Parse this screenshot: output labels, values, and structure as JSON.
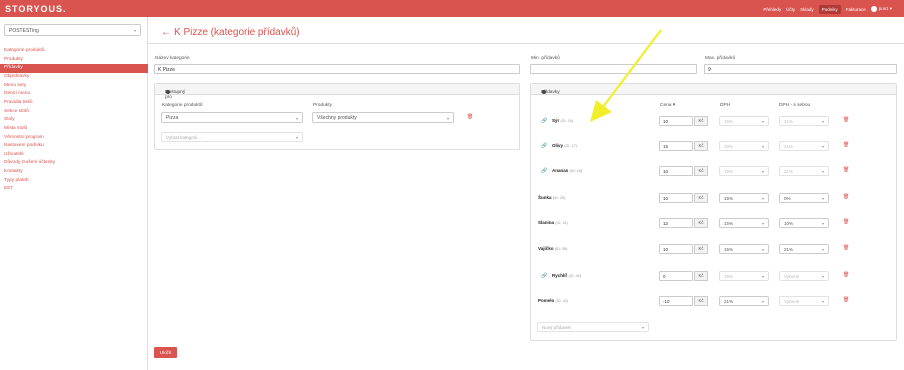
{
  "app": {
    "logo": "STORYOUS."
  },
  "topnav": {
    "items": [
      "Přehledy",
      "Účty",
      "Sklady",
      "Podniky",
      "Fakturace"
    ],
    "active": "Podniky",
    "user": "pos1 ▾"
  },
  "sidebar": {
    "business_select": "POSTESTing",
    "items": [
      "Kategorie produktů",
      "Produkty",
      "Přídavky",
      "Objednávky",
      "Menu sety",
      "Denní menu",
      "Pravidla tisků",
      "Sekce stolů",
      "Stoly",
      "Místa stolů",
      "Věrnostní program",
      "Nastavení podniku",
      "Uživatelé",
      "Důvody zrušení účtenky",
      "Kontakty",
      "Typy plateb",
      "EET"
    ],
    "active_item": "Přídavky"
  },
  "page": {
    "back": "←",
    "title": "K Pizze (kategorie přídavků)"
  },
  "form": {
    "category_name_label": "Název kategorie",
    "category_name_value": "K Pizze",
    "min_label": "Min. přídavků",
    "min_value": "",
    "max_label": "Max. přídavků",
    "max_value": "9"
  },
  "available_for": {
    "title": "Dostupný pro",
    "col_category": "Kategorie produktů",
    "col_products": "Produkty",
    "category_value": "Pizza",
    "products_value": "Všechny produkty",
    "choose_category_placeholder": "Vybrat kategorii..."
  },
  "addons": {
    "title": "Přídavky",
    "col_price": "Cena ▾",
    "col_vat": "DPH",
    "col_vat_takeaway": "DPH - s sebou",
    "currency": "Kč",
    "rows": [
      {
        "name": "Sýr",
        "id": "(ID: 19)",
        "linked": true,
        "price": "10",
        "vat": "15%",
        "vat_takeaway": "21%",
        "dim": true
      },
      {
        "name": "Olivy",
        "id": "(ID: 17)",
        "linked": true,
        "price": "15",
        "vat": "15%",
        "vat_takeaway": "21%",
        "dim": true
      },
      {
        "name": "Ananas",
        "id": "(ID: 18)",
        "linked": true,
        "price": "10",
        "vat": "15%",
        "vat_takeaway": "21%",
        "dim": true
      },
      {
        "name": "Šunka",
        "id": "(ID: 30)",
        "linked": false,
        "price": "10",
        "vat": "15%",
        "vat_takeaway": "0%",
        "dim": false
      },
      {
        "name": "Slanina",
        "id": "(ID: 31)",
        "linked": false,
        "price": "12",
        "vat": "15%",
        "vat_takeaway": "10%",
        "dim": false
      },
      {
        "name": "Vajíčko",
        "id": "(ID: 39)",
        "linked": false,
        "price": "10",
        "vat": "15%",
        "vat_takeaway": "21%",
        "dim": false
      },
      {
        "name": "Rychlíř",
        "id": "(ID: 40)",
        "linked": true,
        "price": "0",
        "vat": "15%",
        "vat_takeaway": "Vyberte",
        "dim": true
      },
      {
        "name": "Pomelo",
        "id": "(ID: 41)",
        "linked": false,
        "price": "-10",
        "vat": "21%",
        "vat_takeaway": "Vyberte",
        "dim": false
      }
    ],
    "new_addon_placeholder": "Nový přídavek"
  },
  "save_label": "Uložit",
  "colors": {
    "brand": "#d9534f",
    "annotation_arrow": "#f2ef2a"
  }
}
